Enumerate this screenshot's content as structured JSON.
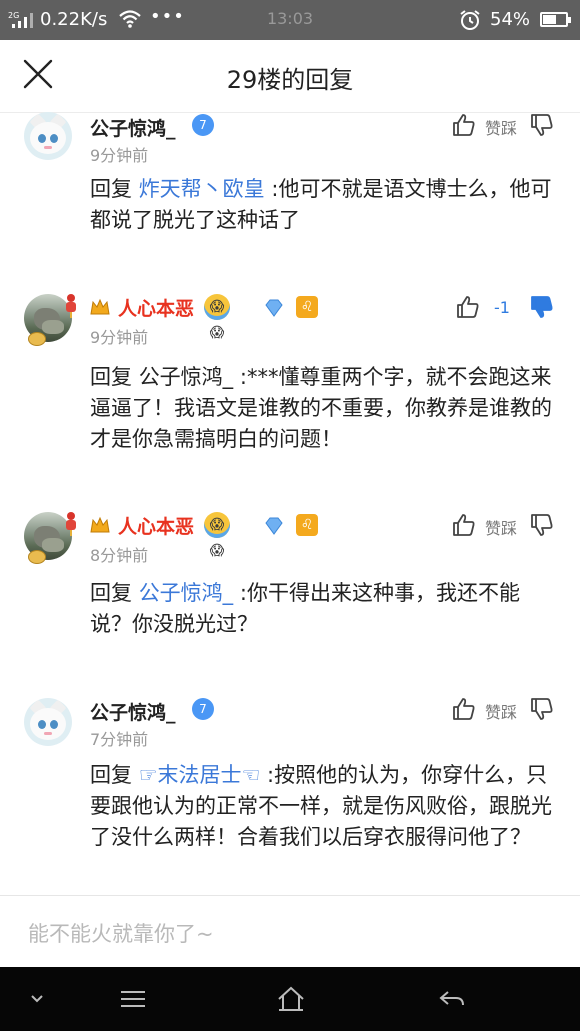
{
  "status_bar": {
    "signal": "2G",
    "net_speed": "0.22K/s",
    "more": "•••",
    "time": "13:03",
    "battery": "54%"
  },
  "header": {
    "title": "29楼的回复"
  },
  "comments": [
    {
      "username": "公子惊鸿_",
      "level": "7",
      "time": "9分钟前",
      "like_label": "赞",
      "dislike_label": "踩",
      "reply_prefix": "回复",
      "mention": "炸天帮丶欧皇",
      "text_after_mention": ":他可不就是语文博士么，他可都说了脱光了这种话了"
    },
    {
      "username": "人心本恶",
      "emojis": "😱😱",
      "time": "9分钟前",
      "vote_count": "-1",
      "reply_prefix": "回复",
      "mention": "公子惊鸿_",
      "text_after_mention": ":***懂尊重两个字，就不会跑这来逼逼了！我语文是谁教的不重要，你教养是谁教的才是你急需搞明白的问题！"
    },
    {
      "username": "人心本恶",
      "emojis": "😱😱",
      "time": "8分钟前",
      "like_label": "赞",
      "dislike_label": "踩",
      "reply_prefix": "回复",
      "mention": "公子惊鸿_",
      "text_after_mention": ":你干得出来这种事，我还不能说？你没脱光过？"
    },
    {
      "username": "公子惊鸿_",
      "level": "7",
      "time": "7分钟前",
      "like_label": "赞",
      "dislike_label": "踩",
      "reply_prefix": "回复",
      "mention": "☞末法居士☜",
      "text_after_mention": ":按照他的认为，你穿什么，只要跟他认为的正常不一样，就是伤风败俗，跟脱光了没什么两样！合着我们以后穿衣服得问他了？"
    }
  ],
  "input": {
    "placeholder": "能不能火就靠你了~"
  },
  "colors": {
    "accent_blue": "#3b78d8",
    "name_red": "#e8321f",
    "status_bar": "#5f5f5f"
  },
  "icons": {
    "close": "close-icon",
    "like": "thumbs-up-icon",
    "dislike": "thumbs-down-icon",
    "nav": [
      "chevron-down-icon",
      "menu-icon",
      "home-icon",
      "back-icon"
    ]
  }
}
